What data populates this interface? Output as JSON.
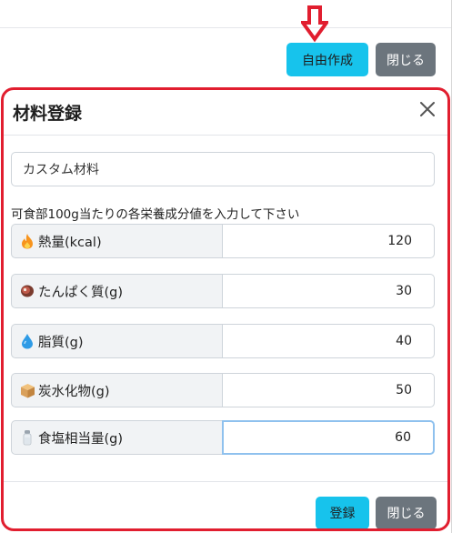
{
  "background": {
    "create_button": "自由作成",
    "close_button": "閉じる"
  },
  "dialog": {
    "title": "材料登録",
    "name_field": {
      "value": "カスタム材料",
      "placeholder": ""
    },
    "instruction": "可食部100g当たりの各栄養成分値を入力して下さい",
    "nutrients": [
      {
        "icon": "fire-icon",
        "label": "熱量(kcal)",
        "value": "120"
      },
      {
        "icon": "meat-icon",
        "label": "たんぱく質(g)",
        "value": "30"
      },
      {
        "icon": "droplet-icon",
        "label": "脂質(g)",
        "value": "40"
      },
      {
        "icon": "box-icon",
        "label": "炭水化物(g)",
        "value": "50"
      },
      {
        "icon": "salt-shaker-icon",
        "label": "食塩相当量(g)",
        "value": "60"
      }
    ],
    "register_button": "登録",
    "close_button": "閉じる"
  },
  "colors": {
    "highlight_border": "#e11e2f",
    "info_button": "#17c3ec",
    "secondary_button": "#6c757d"
  }
}
